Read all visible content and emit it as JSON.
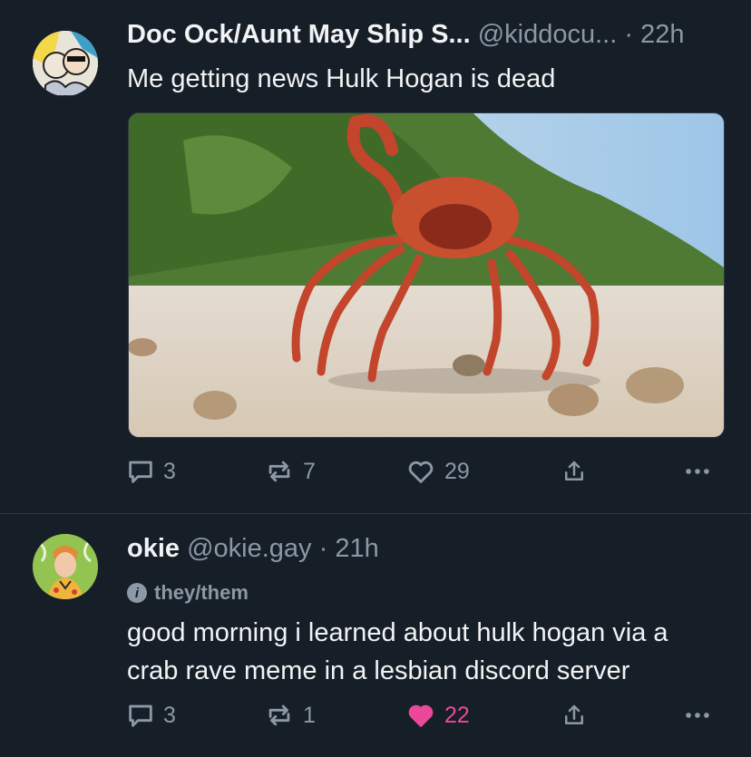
{
  "posts": [
    {
      "author_name": "Doc Ock/Aunt May Ship S...",
      "handle": "@kiddocu...",
      "separator": "·",
      "time": "22h",
      "text": "Me getting news Hulk Hogan is dead",
      "media_alt": "crab rave gif",
      "actions": {
        "replies": "3",
        "reposts": "7",
        "likes": "29"
      },
      "liked": false
    },
    {
      "author_name": "okie",
      "handle": "@okie.gay",
      "separator": "·",
      "time": "21h",
      "pronoun_icon": "i",
      "pronouns": "they/them",
      "text_line1": "good morning i learned about hulk hogan via a",
      "text_line2": "crab rave meme in a lesbian discord server",
      "actions": {
        "replies": "3",
        "reposts": "1",
        "likes": "22"
      },
      "liked": true
    }
  ],
  "colors": {
    "background": "#161e27",
    "muted": "#8b98a5",
    "like_active": "#ec4899",
    "divider": "#2e3a46"
  }
}
